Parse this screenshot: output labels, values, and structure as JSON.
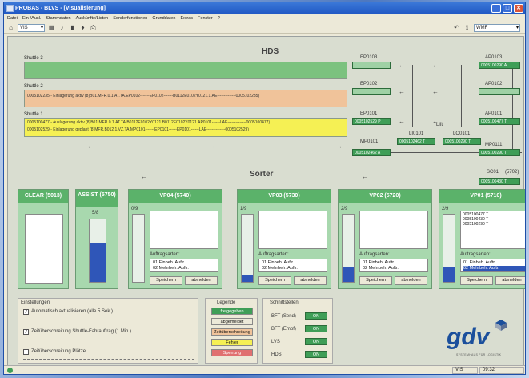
{
  "window": {
    "title": "PROBAS - BLVS - [Visualisierung]",
    "min_label": "_",
    "max_label": "□",
    "close_label": "✕"
  },
  "menu": [
    "Datei",
    "Ein-/Ausl.",
    "Stammdaten",
    "Auskünfte/Listen",
    "Sonderfunktionen",
    "Grunddaten",
    "Extras",
    "Fenster",
    "?"
  ],
  "toolbar": {
    "combo_left": "VIS",
    "combo_right": "WMF"
  },
  "hds": {
    "title": "HDS",
    "shuttle3": {
      "label": "Shuttle 3",
      "text": ""
    },
    "shuttle2": {
      "label": "Shuttle 2",
      "text": "0005102235 - Einlagerung aktiv (8)B01.MFR.0.1.AT.TA.EP0102-------EP0102-------B0112E0102Y0121.1.AE--------------0005102235)"
    },
    "shuttle1": {
      "label": "Shuttle 1",
      "text_a": "0005100477 - Auslagerung aktiv (8)B01.MFR.0.1.AT.TA.B0112E0102Y0121.B0112E0102Y0121.AP0101------LAE--------------0005100477)",
      "text_b": "0005102529 - Einlagerung geplant (8)MFR.B012.1.VZ.TA.MP0101-------EP0101------EP0101------LAE--------------0005102529)"
    },
    "nodes": {
      "ep0103": {
        "label": "EP0103",
        "box": ""
      },
      "ep0102": {
        "label": "EP0102",
        "box": ""
      },
      "ep0101": {
        "label": "EP0101",
        "box": "0005102529 P"
      },
      "mp0101": {
        "label": "MP0101",
        "box": "0005102462 A"
      },
      "ap0103": {
        "label": "AP0103",
        "box": "0005100290 A"
      },
      "ap0102": {
        "label": "AP0102",
        "box": ""
      },
      "ap0101": {
        "label": "AP0101",
        "box": "0005100477 T"
      },
      "mp0111": {
        "label": "MP0111",
        "box": "0005100290 T"
      },
      "li0101": {
        "label": "LI0101",
        "box": "0005102462 T"
      },
      "lo0101": {
        "label": "LO0101",
        "box": "0005100290 T"
      },
      "lift": {
        "label": "Lift"
      }
    }
  },
  "sorter": {
    "title": "Sorter",
    "sc01": {
      "label": "SC01",
      "code": "(5702)",
      "box": "0005100430 T"
    },
    "clear": {
      "title": "CLEAR (5013)"
    },
    "assist": {
      "title": "ASSIST (5750)",
      "count": "5/8",
      "fill_fraction": 0.62
    },
    "stations": [
      {
        "title": "VP04 (5740)",
        "count": "0/9",
        "fill_fraction": 0.0,
        "orders": [],
        "selected_index": -1
      },
      {
        "title": "VP03 (5730)",
        "count": "1/9",
        "fill_fraction": 0.11,
        "orders": [],
        "selected_index": -1
      },
      {
        "title": "VP02 (5720)",
        "count": "2/9",
        "fill_fraction": 0.22,
        "orders": [],
        "selected_index": -1
      },
      {
        "title": "VP01 (5710)",
        "count": "2/9",
        "fill_fraction": 0.22,
        "orders": [
          "0005100477 T",
          "0005100430 T",
          "0005100290 T"
        ],
        "selected_index": 1
      }
    ],
    "auftragsarten_label": "Auftragsarten:",
    "auftrag_options": [
      "01 Einbeh. Auftr.",
      "02 Mehrbeh. Auftr."
    ],
    "save_label": "Speichern",
    "logout_label": "abmelden"
  },
  "settings": {
    "title": "Einstellungen",
    "items": [
      {
        "label": "Automatisch aktualisieren (alle 5 Sek.)",
        "checked": true
      },
      {
        "label": "Zeitüberschreitung Shuttle-Fahrauftrag (1 Min.)",
        "checked": true
      },
      {
        "label": "Zeitüberschreitung Plätze",
        "checked": false
      }
    ]
  },
  "legend": {
    "title": "Legende",
    "items": [
      {
        "label": "freigegeben",
        "color": "#3f9e57"
      },
      {
        "label": "abgemeldet",
        "color": "#ece9d8"
      },
      {
        "label": "Zeitüberschreitung",
        "color": "#f0c39a"
      },
      {
        "label": "Fehler",
        "color": "#f5f054"
      },
      {
        "label": "Sperrung",
        "color": "#e07070"
      }
    ]
  },
  "interfaces": {
    "title": "Schnittstellen",
    "items": [
      {
        "label": "BFT (Send)",
        "state": "ON"
      },
      {
        "label": "BFT (Empf)",
        "state": "ON"
      },
      {
        "label": "LVS",
        "state": "ON"
      },
      {
        "label": "HDS",
        "state": "ON"
      }
    ]
  },
  "logo": {
    "text": "gdv",
    "subtitle": "SYSTEMHAUS FÜR LOGISTIK"
  },
  "status": {
    "mode": "VIS",
    "time": "09:32"
  },
  "colors": {
    "green": "#3f9e57",
    "orange": "#f0c39a",
    "yellow": "#f5f054",
    "blue": "#2f56b8"
  }
}
